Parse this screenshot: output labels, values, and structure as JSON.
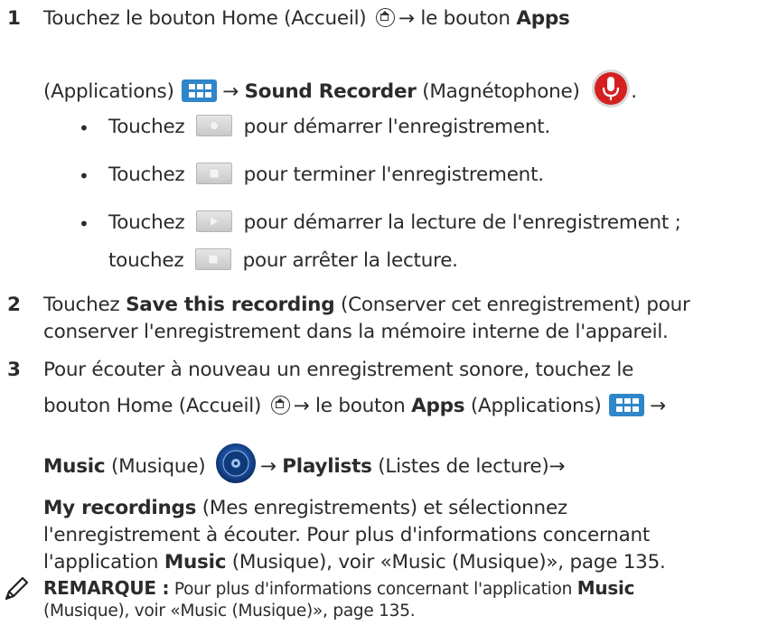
{
  "step1": {
    "number": "1",
    "line1_a": "Touchez le bouton Home (Accueil)",
    "line1_b": "→ le bouton ",
    "line1_bold": "Apps",
    "line2_a": "(Applications)",
    "line2_b": "→ ",
    "line2_bold": "Sound Recorder",
    "line2_c": " (Magnétophone)",
    "line2_end": ".",
    "bullets": [
      {
        "a": "Touchez",
        "b": "pour démarrer l'enregistrement."
      },
      {
        "a": "Touchez",
        "b": "pour terminer l'enregistrement."
      },
      {
        "a": "Touchez",
        "b": "pour démarrer la lecture de l'enregistrement ;",
        "c": "touchez",
        "d": "pour arrêter la lecture."
      }
    ]
  },
  "step2": {
    "number": "2",
    "a": "Touchez ",
    "bold": "Save this recording",
    "b": " (Conserver cet enregistrement) pour",
    "line2": "conserver l'enregistrement dans la mémoire interne de l'appareil."
  },
  "step3": {
    "number": "3",
    "line1": "Pour écouter à nouveau un enregistrement sonore, touchez le",
    "line2_a": "bouton Home (Accueil)",
    "line2_b": "→ le bouton ",
    "line2_bold": "Apps",
    "line2_c": " (Applications)",
    "line2_d": "→",
    "line3_bold": "Music",
    "line3_a": " (Musique)",
    "line3_b": "→ ",
    "line3_bold2": "Playlists",
    "line3_c": " (Listes de lecture)→",
    "line4_bold": "My recordings",
    "line4_a": " (Mes enregistrements) et sélectionnez",
    "line5": "l'enregistrement à écouter. Pour plus d'informations concernant",
    "line6_a": "l'application ",
    "line6_bold": "Music",
    "line6_b": " (Musique), voir «Music (Musique)», page 135."
  },
  "note": {
    "label": "REMARQUE :",
    "text_a": " Pour plus d'informations concernant l'application ",
    "bold": "Music",
    "line2": "(Musique), voir «Music (Musique)», page 135."
  },
  "icons": [
    "home-icon",
    "apps-icon",
    "microphone-icon",
    "record-button-icon",
    "stop-button-icon",
    "play-button-icon",
    "music-icon",
    "note-pencil-icon"
  ],
  "colors": {
    "text": "#2b2b2b",
    "apps_blue": "#2f86c8",
    "mic_red": "#d42020",
    "music_blue": "#1a4f9e"
  }
}
